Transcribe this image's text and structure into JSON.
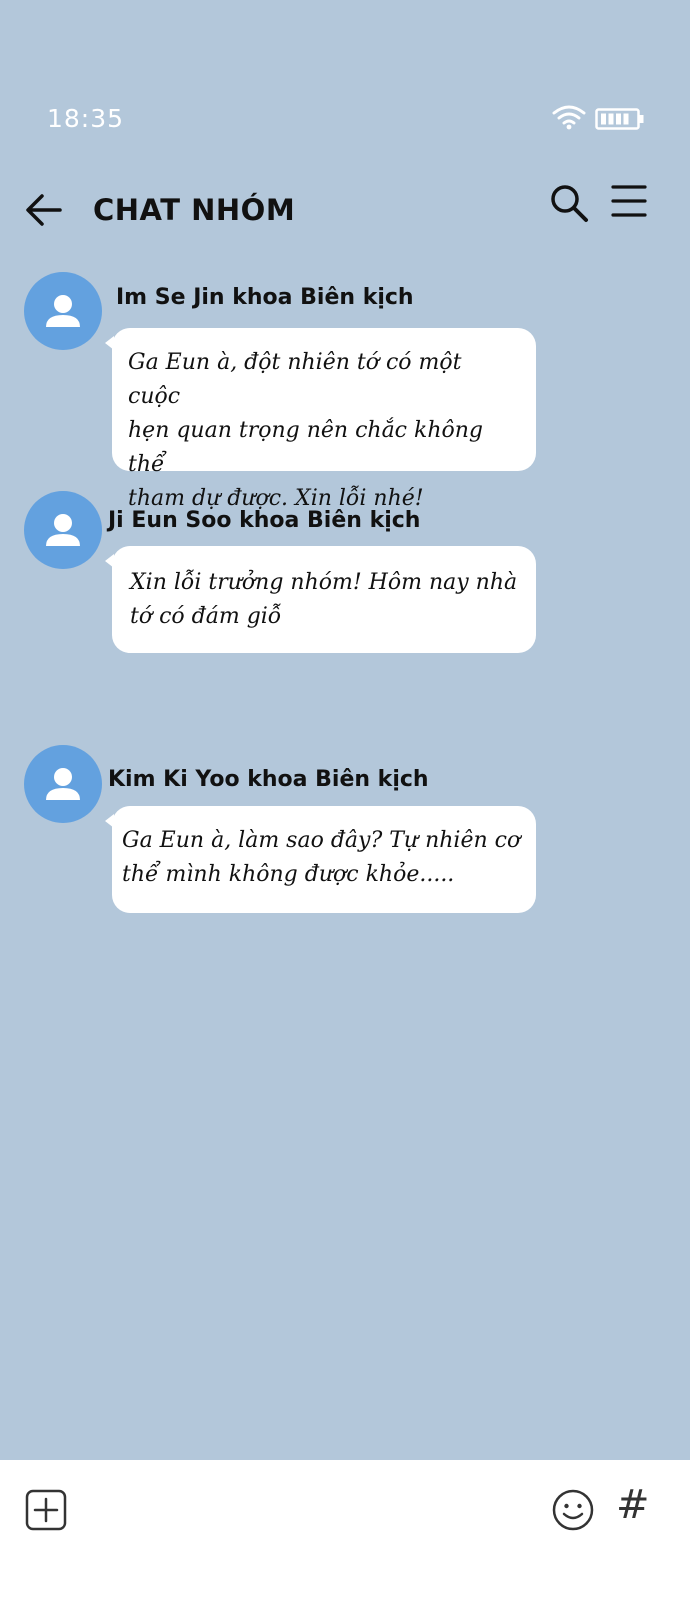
{
  "status_bar": {
    "time": "18:35",
    "wifi_icon": "wifi-icon",
    "battery_icon": "battery-icon"
  },
  "header": {
    "title": "CHAT NHÓM",
    "back_icon": "arrow-left-icon",
    "search_icon": "search-icon",
    "menu_icon": "hamburger-menu-icon"
  },
  "messages": [
    {
      "sender": "Im Se Jin khoa Biên kịch",
      "lines": [
        "Ga Eun à, đột nhiên tớ có một cuộc",
        "hẹn quan trọng nên chắc không thể",
        "tham dự được. Xin lỗi nhé!"
      ]
    },
    {
      "sender": "Ji Eun Soo khoa Biên kịch",
      "lines": [
        "Xin lỗi trưởng nhóm! Hôm nay nhà",
        "tớ có đám giỗ"
      ]
    },
    {
      "sender": "Kim Ki Yoo khoa Biên kịch",
      "lines": [
        "Ga Eun à, làm sao đây? Tự nhiên cơ",
        "thể mình không được khỏe....."
      ]
    }
  ],
  "bottom_bar": {
    "add_icon": "plus-square-icon",
    "emoji_icon": "smiley-icon",
    "hash_label": "#"
  },
  "colors": {
    "background": "#b3c7da",
    "avatar": "#63a1df",
    "bubble": "#ffffff"
  }
}
